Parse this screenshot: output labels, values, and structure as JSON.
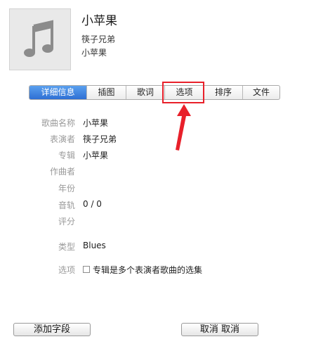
{
  "song": {
    "title": "小苹果",
    "artist": "筷子兄弟",
    "album": "小苹果",
    "artwork_icon": "music-note-icon"
  },
  "tabs": [
    {
      "label": "详细信息",
      "active": true
    },
    {
      "label": "插图",
      "active": false
    },
    {
      "label": "歌词",
      "active": false
    },
    {
      "label": "选项",
      "active": false
    },
    {
      "label": "排序",
      "active": false
    },
    {
      "label": "文件",
      "active": false
    }
  ],
  "details": {
    "song_name_label": "歌曲名称",
    "song_name_value": "小苹果",
    "artist_label": "表演者",
    "artist_value": "筷子兄弟",
    "album_label": "专辑",
    "album_value": "小苹果",
    "composer_label": "作曲者",
    "year_label": "年份",
    "track_label": "音轨",
    "track_value": "0 / 0",
    "rating_label": "评分",
    "genre_label": "类型",
    "genre_value": "Blues",
    "options_label": "选项",
    "compilation_label": "专辑是多个表演者歌曲的选集",
    "compilation_checked": false
  },
  "buttons": {
    "add_field": "添加字段",
    "cancel": "取消 取消"
  },
  "colors": {
    "active_tab": "#3a7fe0",
    "highlight": "#e8202a",
    "label_gray": "#9a9a9a"
  }
}
